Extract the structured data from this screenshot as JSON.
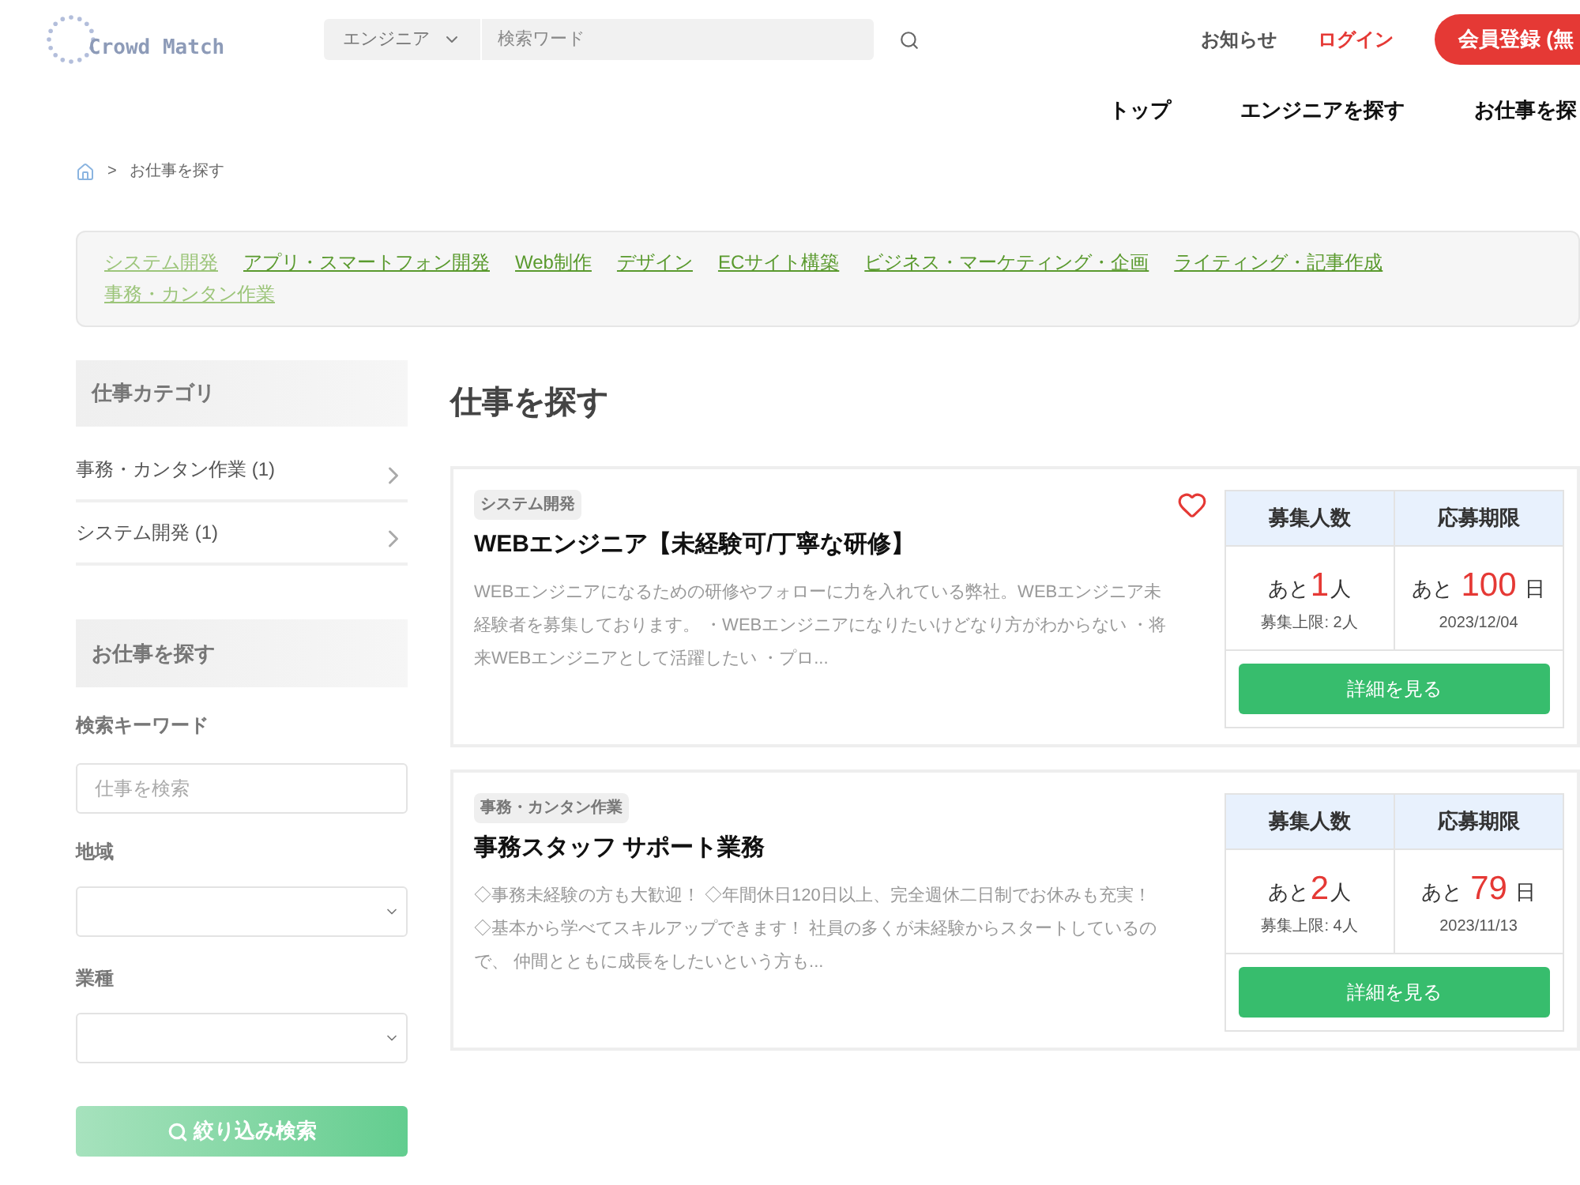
{
  "header": {
    "logo": "Crowd Match",
    "search_category": "エンジニア",
    "search_placeholder": "検索ワード",
    "links": [
      {
        "label": "お知らせ",
        "kind": "plain"
      },
      {
        "label": "ログイン",
        "kind": "accent"
      }
    ],
    "register_button": "会員登録 (無"
  },
  "nav": [
    "トップ",
    "エンジニアを探す",
    "お仕事を探"
  ],
  "breadcrumb": [
    {
      "separator": ">",
      "label": "お仕事を探す"
    }
  ],
  "category_links": [
    {
      "label": "システム開発",
      "visited": true
    },
    {
      "label": "アプリ・スマートフォン開発",
      "visited": false
    },
    {
      "label": "Web制作",
      "visited": false
    },
    {
      "label": "デザイン",
      "visited": false
    },
    {
      "label": "ECサイト構築",
      "visited": false
    },
    {
      "label": "ビジネス・マーケティング・企画",
      "visited": false
    },
    {
      "label": "ライティング・記事作成",
      "visited": false
    },
    {
      "label": "事務・カンタン作業",
      "visited": true
    }
  ],
  "sidebar": {
    "category_title": "仕事カテゴリ",
    "categories": [
      "事務・カンタン作業 (1)",
      "システム開発 (1)"
    ],
    "search_title": "お仕事を探す",
    "keyword_label": "検索キーワード",
    "keyword_placeholder": "仕事を検索",
    "region_label": "地域",
    "industry_label": "業種",
    "filter_button": "絞り込み検索"
  },
  "page_title": "仕事を探す",
  "jobs": [
    {
      "tag": "システム開発",
      "title": "WEBエンジニア【未経験可/丁寧な研修】",
      "description": "WEBエンジニアになるための研修やフォローに力を入れている弊社。WEBエンジニア未経験者を募集しております。 ・WEBエンジニアになりたいけどなり方がわからない ・将来WEBエンジニアとして活躍したい ・プロ...",
      "favorite": true,
      "headcount_header": "募集人数",
      "deadline_header": "応募期限",
      "remaining_prefix": "あと",
      "remaining_count": "1",
      "remaining_unit": "人",
      "limit": "募集上限: 2人",
      "days_prefix": "あと",
      "days": "100",
      "days_unit": "日",
      "deadline": "2023/12/04",
      "detail_button": "詳細を見る"
    },
    {
      "tag": "事務・カンタン作業",
      "title": "事務スタッフ サポート業務",
      "description": "◇事務未経験の方も大歓迎！ ◇年間休日120日以上、完全週休二日制でお休みも充実！ ◇基本から学べてスキルアップできます！ 社員の多くが未経験からスタートしているので、 仲間とともに成長をしたいという方も...",
      "favorite": false,
      "headcount_header": "募集人数",
      "deadline_header": "応募期限",
      "remaining_prefix": "あと",
      "remaining_count": "2",
      "remaining_unit": "人",
      "limit": "募集上限: 4人",
      "days_prefix": "あと",
      "days": "79",
      "days_unit": "日",
      "deadline": "2023/11/13",
      "detail_button": "詳細を見る"
    }
  ]
}
